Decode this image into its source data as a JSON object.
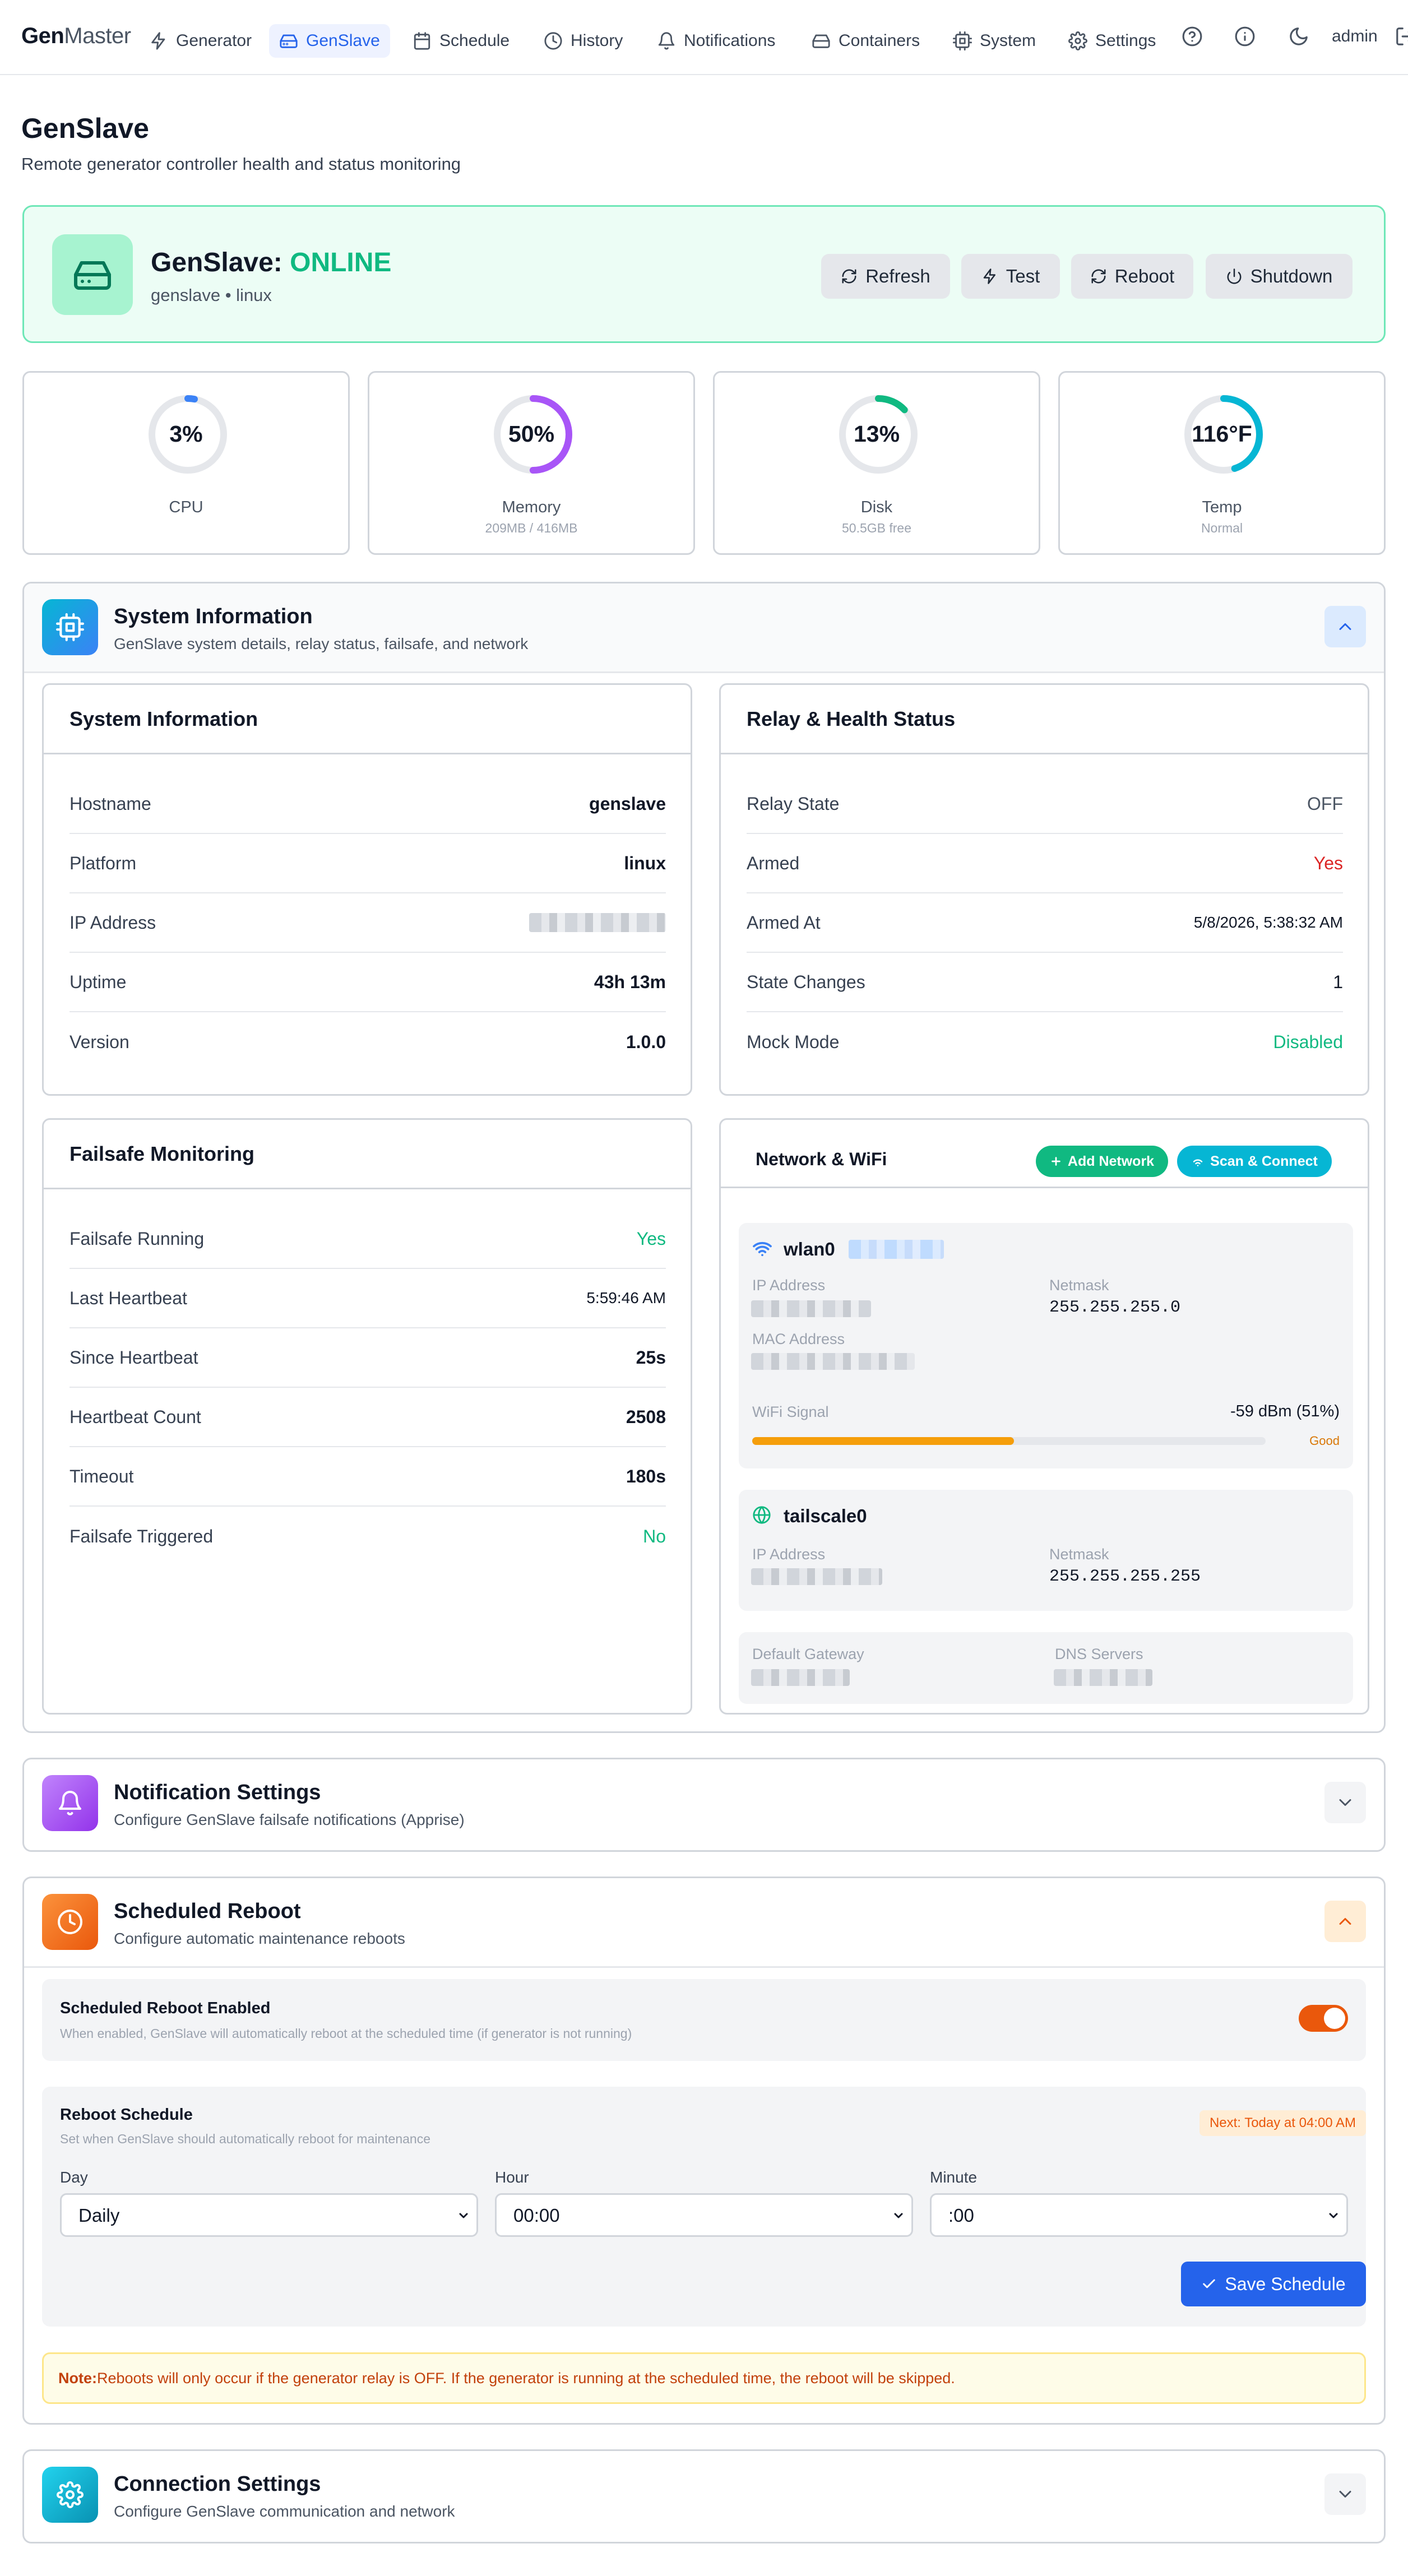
{
  "nav": {
    "logo_bold": "Gen",
    "logo_light": "Master",
    "items": [
      {
        "label": "Generator",
        "icon": "bolt-icon"
      },
      {
        "label": "GenSlave",
        "icon": "drive-icon",
        "active": true
      },
      {
        "label": "Schedule",
        "icon": "calendar-icon"
      },
      {
        "label": "History",
        "icon": "clock-icon"
      },
      {
        "label": "Notifications",
        "icon": "bell-icon"
      },
      {
        "label": "Containers",
        "icon": "server-icon"
      },
      {
        "label": "System",
        "icon": "cpu-icon"
      },
      {
        "label": "Settings",
        "icon": "gear-icon"
      }
    ],
    "user": "admin"
  },
  "page": {
    "title": "GenSlave",
    "subtitle": "Remote generator controller health and status monitoring"
  },
  "status": {
    "title_prefix": "GenSlave: ",
    "state": "ONLINE",
    "host_info": "genslave • linux",
    "buttons": {
      "refresh": "Refresh",
      "test": "Test",
      "reboot": "Reboot",
      "shutdown": "Shutdown"
    }
  },
  "gauges": [
    {
      "value": "3%",
      "label": "CPU",
      "sub": "",
      "fraction": 0.03,
      "color": "#3b82f6"
    },
    {
      "value": "50%",
      "label": "Memory",
      "sub": "209MB / 416MB",
      "fraction": 0.5,
      "color": "#a855f7"
    },
    {
      "value": "13%",
      "label": "Disk",
      "sub": "50.5GB free",
      "fraction": 0.13,
      "color": "#10b981"
    },
    {
      "value": "116°F",
      "label": "Temp",
      "sub": "Normal",
      "fraction": 0.45,
      "color": "#06b6d4"
    }
  ],
  "system_section": {
    "title": "System Information",
    "subtitle": "GenSlave system details, relay status, failsafe, and network",
    "sysinfo": {
      "title": "System Information",
      "hostname_label": "Hostname",
      "hostname": "genslave",
      "platform_label": "Platform",
      "platform": "linux",
      "ip_label": "IP Address",
      "uptime_label": "Uptime",
      "uptime": "43h 13m",
      "version_label": "Version",
      "version": "1.0.0"
    },
    "relay": {
      "title": "Relay & Health Status",
      "relay_state_label": "Relay State",
      "relay_state": "OFF",
      "armed_label": "Armed",
      "armed": "Yes",
      "armed_at_label": "Armed At",
      "armed_at": "5/8/2026, 5:38:32 AM",
      "state_changes_label": "State Changes",
      "state_changes": "1",
      "mock_mode_label": "Mock Mode",
      "mock_mode": "Disabled"
    },
    "failsafe": {
      "title": "Failsafe Monitoring",
      "running_label": "Failsafe Running",
      "running": "Yes",
      "last_hb_label": "Last Heartbeat",
      "last_hb": "5:59:46 AM",
      "since_hb_label": "Since Heartbeat",
      "since_hb": "25s",
      "hb_count_label": "Heartbeat Count",
      "hb_count": "2508",
      "timeout_label": "Timeout",
      "timeout": "180s",
      "triggered_label": "Failsafe Triggered",
      "triggered": "No"
    },
    "network": {
      "title": "Network & WiFi",
      "add_network": "Add Network",
      "scan_connect": "Scan & Connect",
      "wlan": {
        "name": "wlan0",
        "ip_label": "IP Address",
        "netmask_label": "Netmask",
        "netmask": "255.255.255.0",
        "mac_label": "MAC Address",
        "signal_label": "WiFi Signal",
        "signal": "-59 dBm (51%)",
        "signal_fraction": 0.51,
        "signal_quality": "Good"
      },
      "tailscale": {
        "name": "tailscale0",
        "ip_label": "IP Address",
        "netmask_label": "Netmask",
        "netmask": "255.255.255.255"
      },
      "gateway_label": "Default Gateway",
      "dns_label": "DNS Servers"
    }
  },
  "notification_section": {
    "title": "Notification Settings",
    "subtitle": "Configure GenSlave failsafe notifications (Apprise)"
  },
  "reboot_section": {
    "title": "Scheduled Reboot",
    "subtitle": "Configure automatic maintenance reboots",
    "enabled_title": "Scheduled Reboot Enabled",
    "enabled_desc": "When enabled, GenSlave will automatically reboot at the scheduled time (if generator is not running)",
    "enabled": true,
    "schedule_title": "Reboot Schedule",
    "schedule_desc": "Set when GenSlave should automatically reboot for maintenance",
    "next_badge": "Next: Today at 04:00 AM",
    "day_label": "Day",
    "day_value": "Daily",
    "hour_label": "Hour",
    "hour_value": "00:00",
    "minute_label": "Minute",
    "minute_value": ":00",
    "save_label": "Save Schedule",
    "note_prefix": "Note:",
    "note_text": " Reboots will only occur if the generator relay is OFF. If the generator is running at the scheduled time, the reboot will be skipped."
  },
  "connection_section": {
    "title": "Connection Settings",
    "subtitle": "Configure GenSlave communication and network"
  }
}
